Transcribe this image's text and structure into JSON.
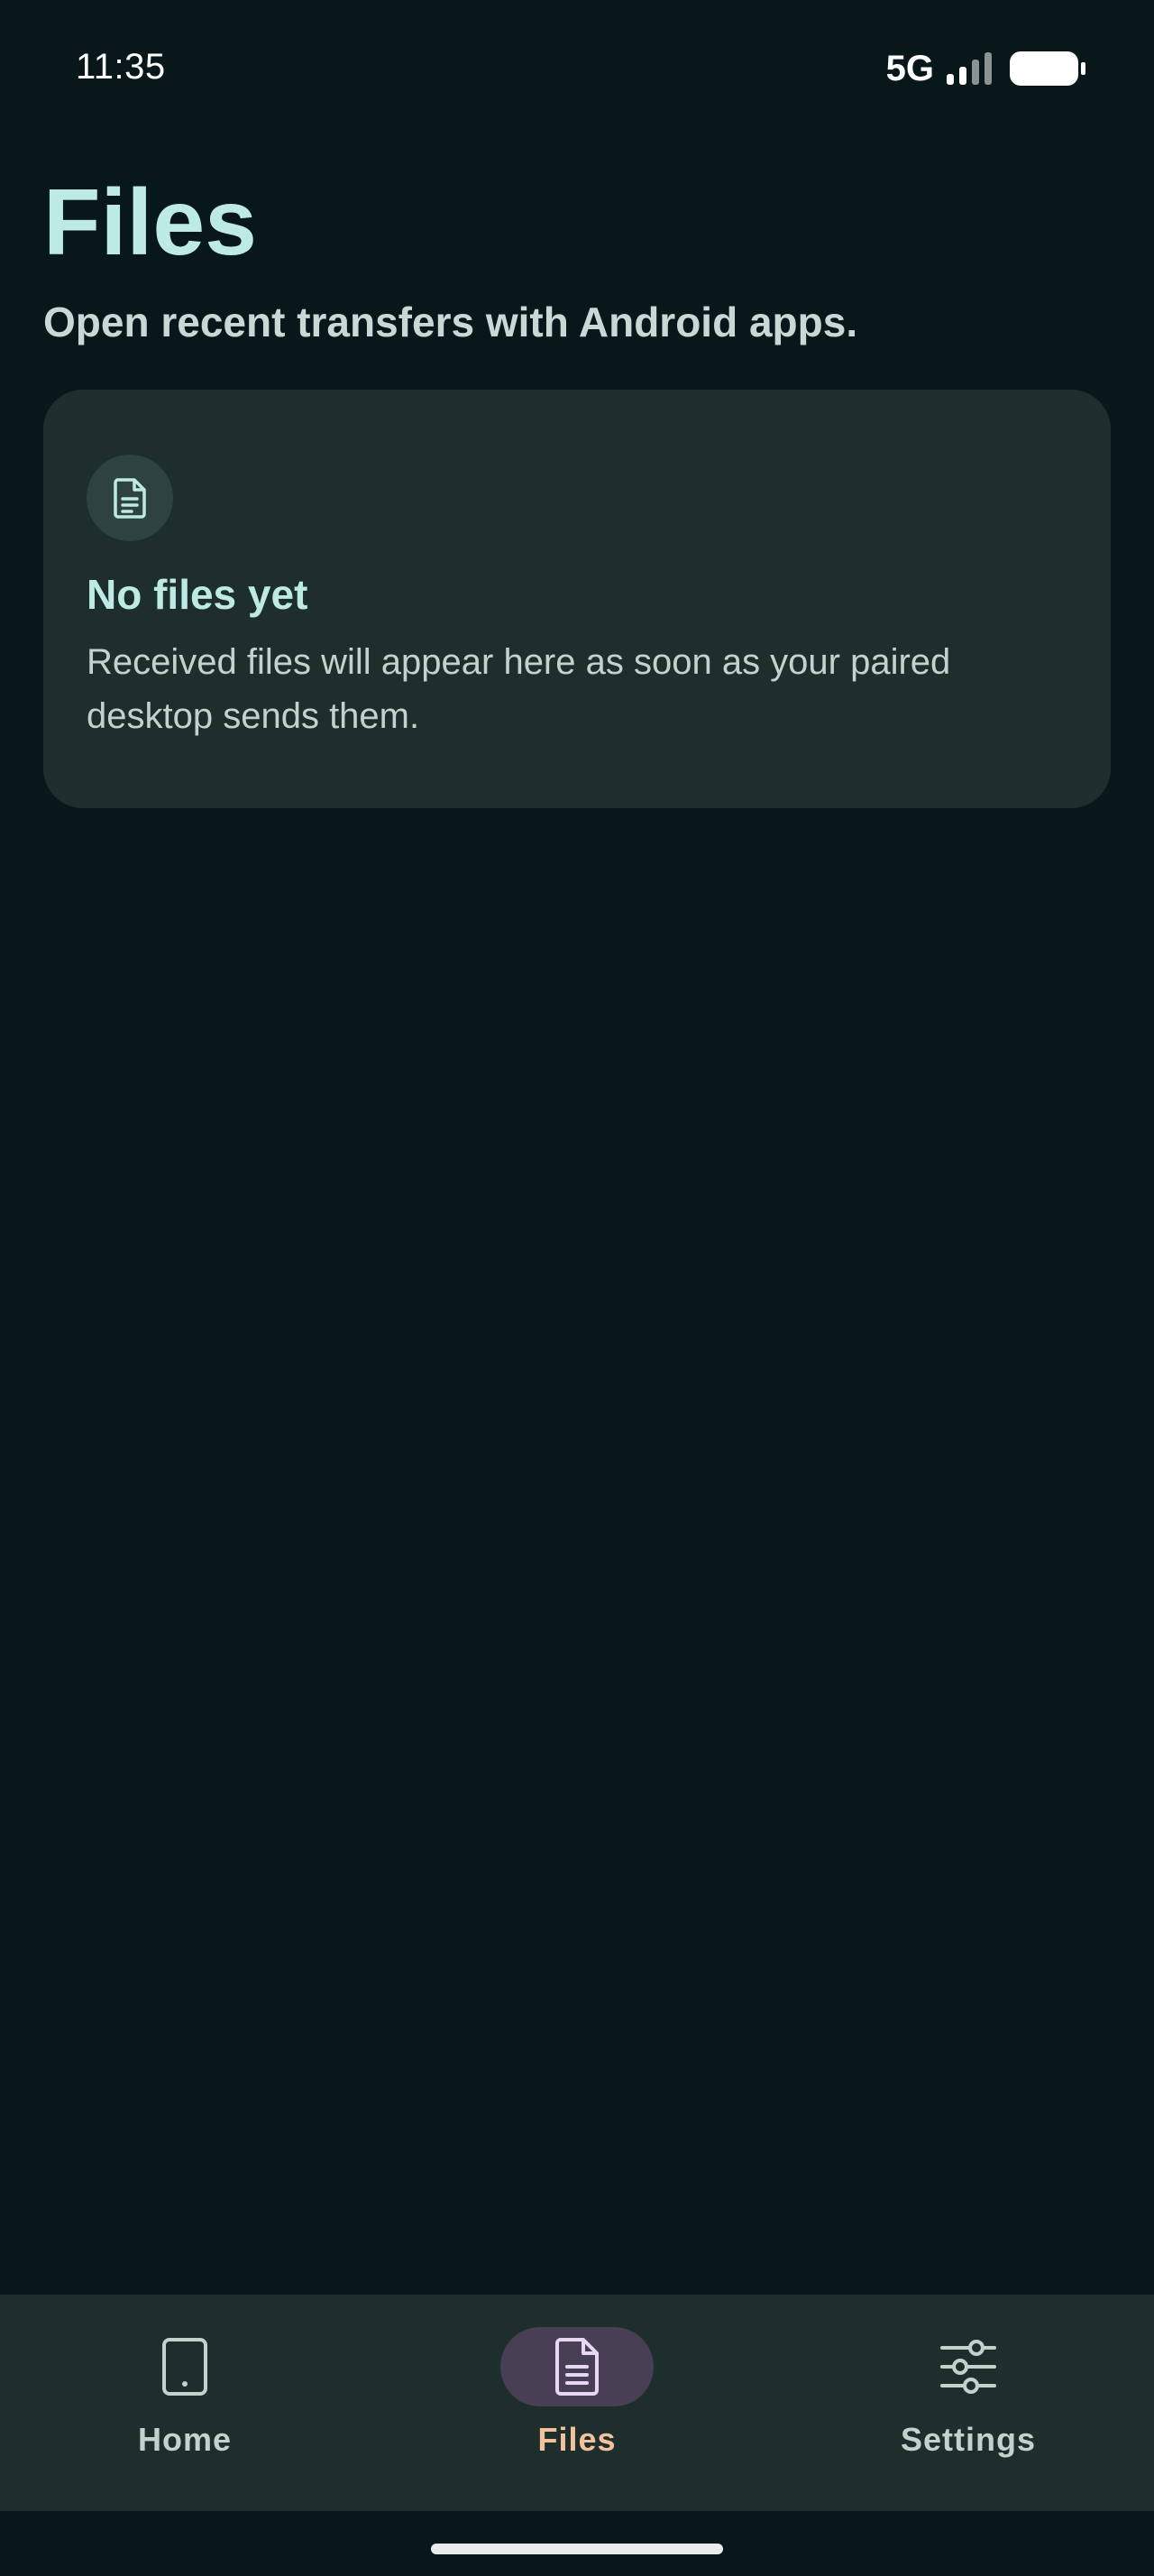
{
  "status_bar": {
    "time": "11:35",
    "network": "5G",
    "signal_level": "2 of 4 bars",
    "battery_level": "full"
  },
  "header": {
    "title": "Files",
    "subtitle": "Open recent transfers with Android apps."
  },
  "empty_state": {
    "icon": "document-icon",
    "title": "No files yet",
    "body": "Received files will appear here as soon as your paired desktop sends them."
  },
  "bottom_nav": {
    "active_tab": "Files",
    "items": [
      {
        "label": "Home",
        "icon": "tablet-icon"
      },
      {
        "label": "Files",
        "icon": "document-icon"
      },
      {
        "label": "Settings",
        "icon": "sliders-icon"
      }
    ]
  },
  "colors": {
    "background": "#08181a",
    "surface": "#1d2e2d",
    "accent_text": "#bdeae2",
    "active_nav_pill": "#483f55",
    "active_nav_label": "#f2c29d"
  }
}
